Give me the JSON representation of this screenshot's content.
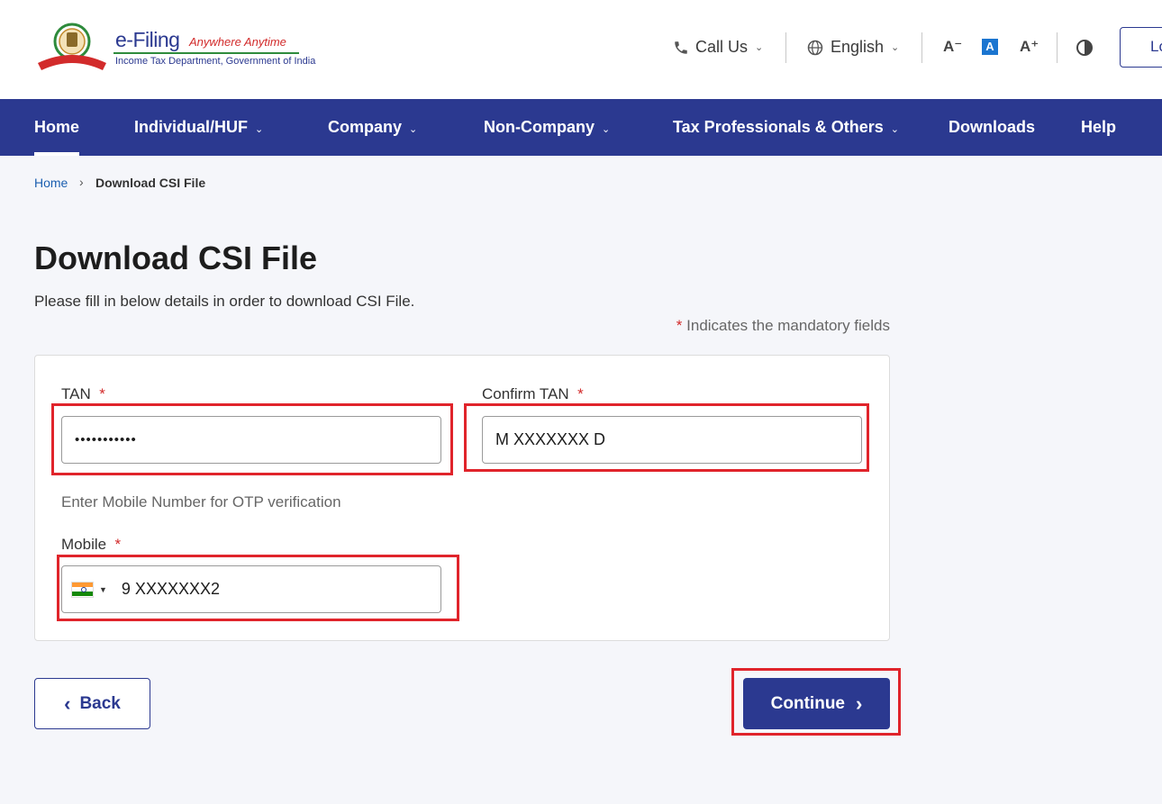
{
  "header": {
    "logo_title": "e-Filing",
    "logo_tagline": "Anywhere Anytime",
    "logo_subtitle": "Income Tax Department, Government of India",
    "call_us": "Call Us",
    "language": "English",
    "font_decrease": "A⁻",
    "font_default": "A",
    "font_increase": "A⁺",
    "login": "Lo"
  },
  "nav": {
    "items": [
      {
        "label": "Home"
      },
      {
        "label": "Individual/HUF"
      },
      {
        "label": "Company"
      },
      {
        "label": "Non-Company"
      },
      {
        "label": "Tax Professionals & Others"
      },
      {
        "label": "Downloads"
      },
      {
        "label": "Help"
      }
    ]
  },
  "breadcrumb": {
    "home": "Home",
    "separator": "›",
    "current": "Download CSI File"
  },
  "page": {
    "title": "Download CSI File",
    "description": "Please fill in below details in order to download CSI File.",
    "mandatory_star": "*",
    "mandatory_note": " Indicates the mandatory fields"
  },
  "form": {
    "tan_label": "TAN",
    "tan_value": "•••••••••••",
    "confirm_tan_label": "Confirm TAN",
    "confirm_tan_value": "M XXXXXXX D",
    "mobile_hint": "Enter Mobile Number for OTP verification",
    "mobile_label": "Mobile",
    "mobile_value": "9 XXXXXXX2",
    "required_mark": "*"
  },
  "buttons": {
    "back": "Back",
    "continue": "Continue"
  },
  "colors": {
    "brand_navy": "#2b3990",
    "highlight_red": "#e0242b",
    "required_red": "#d22b2b",
    "link_blue": "#1b5fb0"
  }
}
